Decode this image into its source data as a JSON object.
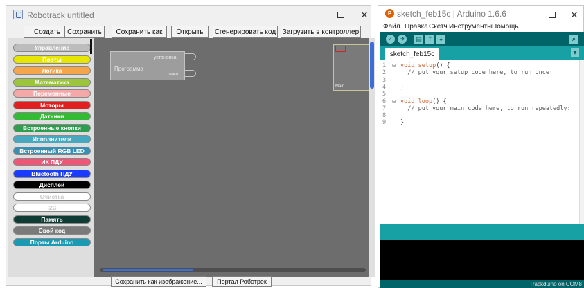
{
  "robotrack": {
    "title": "Robotrack untitled",
    "window_controls": {
      "min": "—",
      "max": "☐",
      "close": "✕"
    },
    "toolbar": [
      "Создать",
      "Сохранить",
      "Сохранить как",
      "Открыть",
      "Сгенерировать код",
      "Загрузить в контроллер"
    ],
    "categories": [
      {
        "label": "Управление",
        "bg": "#bdbdbd",
        "fg": "#ffffff"
      },
      {
        "label": "Порты",
        "bg": "#e6e600",
        "fg": "#ffffff"
      },
      {
        "label": "Логика",
        "bg": "#f5a54a",
        "fg": "#ffffff"
      },
      {
        "label": "Математика",
        "bg": "#9bc53d",
        "fg": "#ffffff"
      },
      {
        "label": "Переменные",
        "bg": "#f4a8a8",
        "fg": "#ffffff"
      },
      {
        "label": "Моторы",
        "bg": "#e02020",
        "fg": "#ffffff"
      },
      {
        "label": "Датчики",
        "bg": "#33bb33",
        "fg": "#ffffff"
      },
      {
        "label": "Встроенные кнопки",
        "bg": "#2e9e4e",
        "fg": "#ffffff"
      },
      {
        "label": "Исполнители",
        "bg": "#48a8c0",
        "fg": "#ffffff"
      },
      {
        "label": "Встроенный RGB LED",
        "bg": "#3a8fb0",
        "fg": "#ffffff"
      },
      {
        "label": "ИК ПДУ",
        "bg": "#ee5577",
        "fg": "#ffffff"
      },
      {
        "label": "Bluetooth ПДУ",
        "bg": "#1a3cff",
        "fg": "#ffffff"
      },
      {
        "label": "Дисплей",
        "bg": "#000000",
        "fg": "#ffffff"
      },
      {
        "label": "Очистка",
        "bg": "#ffffff",
        "fg": "#c8c8c8"
      },
      {
        "label": "I2C",
        "bg": "#ffffff",
        "fg": "#c8c8c8"
      },
      {
        "label": "Память",
        "bg": "#0e3b33",
        "fg": "#ffffff"
      },
      {
        "label": "Свой код",
        "bg": "#7a7a7a",
        "fg": "#ffffff"
      },
      {
        "label": "Порты Arduino",
        "bg": "#1b9bb3",
        "fg": "#ffffff"
      }
    ],
    "program_block": {
      "title": "Программа",
      "slot1": "установка",
      "slot2": "цикл"
    },
    "minimap_label": "Main",
    "bottom_buttons": [
      "Сохранить как изображение...",
      "Портал Роботрек"
    ]
  },
  "arduino": {
    "title": "sketch_feb15c | Arduino 1.6.6",
    "icon_glyph": "P",
    "window_controls": {
      "min": "—",
      "max": "☐",
      "close": "✕"
    },
    "menu": [
      "Файл",
      "Правка",
      "Скетч",
      "Инструменты",
      "Помощь"
    ],
    "toolbar_icons": [
      "verify-icon",
      "upload-icon",
      "new-icon",
      "open-icon",
      "save-icon",
      "serial-monitor-icon"
    ],
    "tab": "sketch_feb15c",
    "lines": [
      {
        "n": "1",
        "fold": "⊟",
        "kw": "void",
        "fn": "setup",
        "rest": "() {",
        "cmt": ""
      },
      {
        "n": "2",
        "fold": "",
        "kw": "",
        "fn": "",
        "rest": "",
        "cmt": "  // put your setup code here, to run once:"
      },
      {
        "n": "3",
        "fold": "",
        "kw": "",
        "fn": "",
        "rest": "",
        "cmt": ""
      },
      {
        "n": "4",
        "fold": "",
        "kw": "",
        "fn": "",
        "rest": "}",
        "cmt": ""
      },
      {
        "n": "5",
        "fold": "",
        "kw": "",
        "fn": "",
        "rest": "",
        "cmt": ""
      },
      {
        "n": "6",
        "fold": "⊟",
        "kw": "void",
        "fn": "loop",
        "rest": "() {",
        "cmt": ""
      },
      {
        "n": "7",
        "fold": "",
        "kw": "",
        "fn": "",
        "rest": "",
        "cmt": "  // put your main code here, to run repeatedly:"
      },
      {
        "n": "8",
        "fold": "",
        "kw": "",
        "fn": "",
        "rest": "",
        "cmt": ""
      },
      {
        "n": "9",
        "fold": "",
        "kw": "",
        "fn": "",
        "rest": "}",
        "cmt": ""
      }
    ],
    "footer": "Trackduino on COM8"
  }
}
